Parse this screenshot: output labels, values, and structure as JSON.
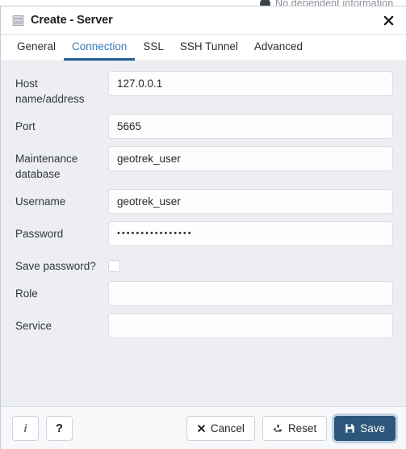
{
  "backdrop": {
    "notice_icon": "circle-alert-icon",
    "notice_text": "No dependent information"
  },
  "dialog": {
    "icon": "server-stack-icon",
    "title": "Create - Server",
    "close_icon": "close-icon",
    "close_label": "✕"
  },
  "tabs": [
    {
      "id": "general",
      "label": "General",
      "active": false
    },
    {
      "id": "connection",
      "label": "Connection",
      "active": true
    },
    {
      "id": "ssl",
      "label": "SSL",
      "active": false
    },
    {
      "id": "ssh-tunnel",
      "label": "SSH Tunnel",
      "active": false
    },
    {
      "id": "advanced",
      "label": "Advanced",
      "active": false
    }
  ],
  "form": {
    "host": {
      "label": "Host name/address",
      "value": "127.0.0.1",
      "placeholder": ""
    },
    "port": {
      "label": "Port",
      "value": "5665",
      "placeholder": ""
    },
    "maintenance_db": {
      "label": "Maintenance database",
      "value": "geotrek_user",
      "placeholder": ""
    },
    "username": {
      "label": "Username",
      "value": "geotrek_user",
      "placeholder": ""
    },
    "password": {
      "label": "Password",
      "value": "••••••••••••••••",
      "placeholder": ""
    },
    "save_password": {
      "label": "Save password?",
      "checked": false
    },
    "role": {
      "label": "Role",
      "value": "",
      "placeholder": ""
    },
    "service": {
      "label": "Service",
      "value": "",
      "placeholder": ""
    }
  },
  "footer": {
    "info_label": "i",
    "help_label": "?",
    "cancel_label": "Cancel",
    "reset_label": "Reset",
    "save_label": "Save"
  },
  "colors": {
    "accent": "#2a5f8f",
    "tab_active_text": "#3a7ab5",
    "save_button": "#2d577a",
    "body_background": "#eceef4",
    "focus_ring": "#c2d4e4"
  }
}
